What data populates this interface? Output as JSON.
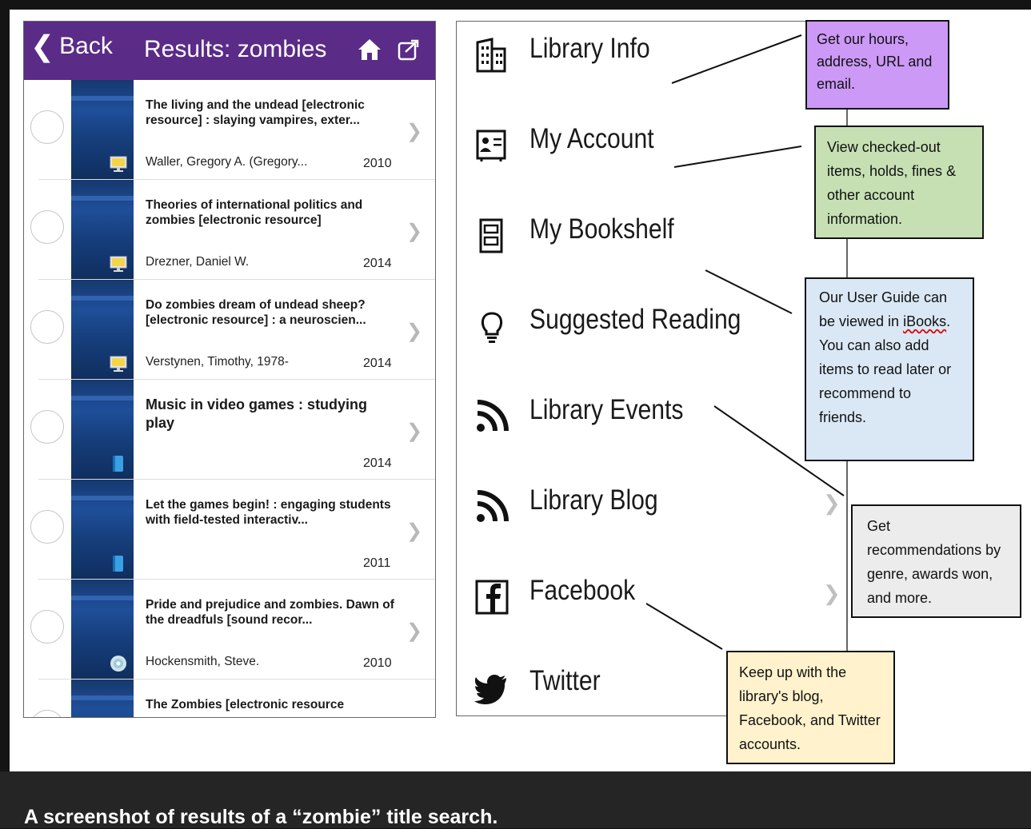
{
  "phone": {
    "nav": {
      "back_label": "Back",
      "title": "Results: zombies"
    },
    "results": [
      {
        "title": "The living and the undead [electronic resource] : slaying vampires, exter...",
        "author": "Waller, Gregory A. (Gregory...",
        "year": "2010",
        "format": "computer-icon",
        "big": false
      },
      {
        "title": "Theories of international politics and zombies [electronic resource]",
        "author": "Drezner, Daniel W.",
        "year": "2014",
        "format": "computer-icon",
        "big": false
      },
      {
        "title": "Do zombies dream of undead sheep? [electronic resource] : a neuroscien...",
        "author": "Verstynen, Timothy, 1978-",
        "year": "2014",
        "format": "computer-icon",
        "big": false
      },
      {
        "title": "Music in video games : studying play",
        "author": "",
        "year": "2014",
        "format": "book-icon",
        "big": true
      },
      {
        "title": "Let the games begin! : engaging students with field-tested interactiv...",
        "author": "",
        "year": "2011",
        "format": "book-icon",
        "big": false
      },
      {
        "title": "Pride and prejudice and zombies. Dawn of the dreadfuls [sound recor...",
        "author": "Hockensmith, Steve.",
        "year": "2010",
        "format": "disc-icon",
        "big": false
      },
      {
        "title": "The Zombies [electronic resource",
        "author": "",
        "year": "",
        "format": "computer-icon",
        "big": false
      }
    ]
  },
  "menu": {
    "items": [
      {
        "label": "Library Info",
        "icon": "building-icon"
      },
      {
        "label": "My Account",
        "icon": "id-card-icon"
      },
      {
        "label": "My Bookshelf",
        "icon": "bookshelf-icon"
      },
      {
        "label": "Suggested Reading",
        "icon": "lightbulb-icon"
      },
      {
        "label": "Library Events",
        "icon": "rss-icon"
      },
      {
        "label": "Library Blog",
        "icon": "rss-icon"
      },
      {
        "label": "Facebook",
        "icon": "facebook-icon"
      },
      {
        "label": "Twitter",
        "icon": "twitter-icon"
      }
    ]
  },
  "callouts": {
    "info": "Get our hours, address, URL and email.",
    "account": "View checked-out items, holds, fines & other account information.",
    "bookshelf_pre": "Our User Guide can be viewed in ",
    "bookshelf_link": "iBooks",
    "bookshelf_post": ". You can also add items to read later or recommend to friends.",
    "suggested": "Get recommendations by genre, awards won, and more.",
    "social": "Keep up with the library's blog, Facebook, and Twitter accounts."
  },
  "caption": "A screenshot of results of a “zombie” title search.",
  "colors": {
    "navbar": "#5a2b87",
    "info": "#cc99f7",
    "account": "#c6e0b4",
    "bookshelf": "#dae8f6",
    "suggested": "#ececec",
    "social": "#fff2cc"
  }
}
